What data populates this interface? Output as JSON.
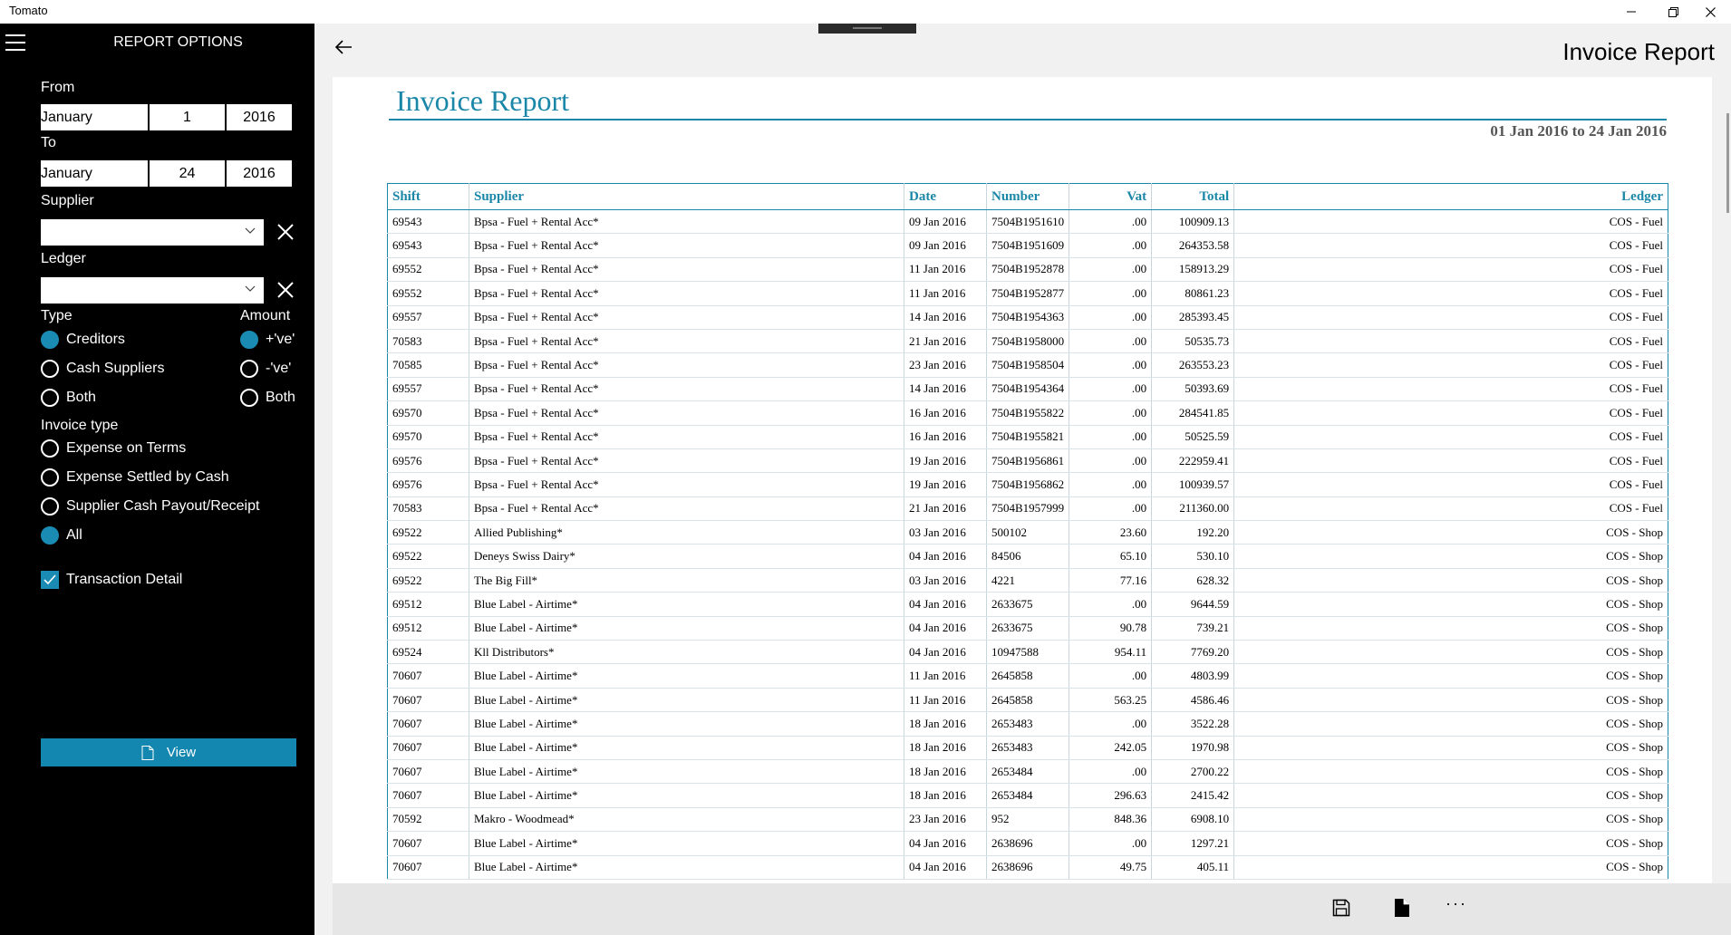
{
  "window": {
    "title": "Tomato",
    "minimize": "—",
    "restore": "❐",
    "close": "✕"
  },
  "sidebar": {
    "title": "REPORT OPTIONS",
    "from_label": "From",
    "from": {
      "month": "January",
      "day": "1",
      "year": "2016"
    },
    "to_label": "To",
    "to": {
      "month": "January",
      "day": "24",
      "year": "2016"
    },
    "supplier_label": "Supplier",
    "supplier_value": "",
    "ledger_label": "Ledger",
    "ledger_value": "",
    "type_label": "Type",
    "type_options": [
      "Creditors",
      "Cash Suppliers",
      "Both"
    ],
    "type_selected": "Creditors",
    "amount_label": "Amount",
    "amount_options": [
      "+'ve'",
      "-'ve'",
      "Both"
    ],
    "amount_selected": "+'ve'",
    "invoice_type_label": "Invoice type",
    "invoice_type_options": [
      "Expense on Terms",
      "Expense Settled by Cash",
      "Supplier Cash Payout/Receipt",
      "All"
    ],
    "invoice_type_selected": "All",
    "transaction_detail_label": "Transaction Detail",
    "transaction_detail_checked": true,
    "view_label": "View",
    "accent_color": "#1a8bb3"
  },
  "header": {
    "title": "Invoice Report"
  },
  "report": {
    "title": "Invoice Report",
    "date_range": "01 Jan 2016 to 24 Jan 2016",
    "columns": [
      "Shift",
      "Supplier",
      "Date",
      "Number",
      "Vat",
      "Total",
      "Ledger"
    ],
    "rows": [
      [
        "69543",
        "Bpsa - Fuel + Rental Acc*",
        "09 Jan 2016",
        "7504B1951610",
        ".00",
        "100909.13",
        "COS - Fuel"
      ],
      [
        "69543",
        "Bpsa - Fuel + Rental Acc*",
        "09 Jan 2016",
        "7504B1951609",
        ".00",
        "264353.58",
        "COS - Fuel"
      ],
      [
        "69552",
        "Bpsa - Fuel + Rental Acc*",
        "11 Jan 2016",
        "7504B1952878",
        ".00",
        "158913.29",
        "COS - Fuel"
      ],
      [
        "69552",
        "Bpsa - Fuel + Rental Acc*",
        "11 Jan 2016",
        "7504B1952877",
        ".00",
        "80861.23",
        "COS - Fuel"
      ],
      [
        "69557",
        "Bpsa - Fuel + Rental Acc*",
        "14 Jan 2016",
        "7504B1954363",
        ".00",
        "285393.45",
        "COS - Fuel"
      ],
      [
        "70583",
        "Bpsa - Fuel + Rental Acc*",
        "21 Jan 2016",
        "7504B1958000",
        ".00",
        "50535.73",
        "COS - Fuel"
      ],
      [
        "70585",
        "Bpsa - Fuel + Rental Acc*",
        "23 Jan 2016",
        "7504B1958504",
        ".00",
        "263553.23",
        "COS - Fuel"
      ],
      [
        "69557",
        "Bpsa - Fuel + Rental Acc*",
        "14 Jan 2016",
        "7504B1954364",
        ".00",
        "50393.69",
        "COS - Fuel"
      ],
      [
        "69570",
        "Bpsa - Fuel + Rental Acc*",
        "16 Jan 2016",
        "7504B1955822",
        ".00",
        "284541.85",
        "COS - Fuel"
      ],
      [
        "69570",
        "Bpsa - Fuel + Rental Acc*",
        "16 Jan 2016",
        "7504B1955821",
        ".00",
        "50525.59",
        "COS - Fuel"
      ],
      [
        "69576",
        "Bpsa - Fuel + Rental Acc*",
        "19 Jan 2016",
        "7504B1956861",
        ".00",
        "222959.41",
        "COS - Fuel"
      ],
      [
        "69576",
        "Bpsa - Fuel + Rental Acc*",
        "19 Jan 2016",
        "7504B1956862",
        ".00",
        "100939.57",
        "COS - Fuel"
      ],
      [
        "70583",
        "Bpsa - Fuel + Rental Acc*",
        "21 Jan 2016",
        "7504B1957999",
        ".00",
        "211360.00",
        "COS - Fuel"
      ],
      [
        "69522",
        "Allied Publishing*",
        "03 Jan 2016",
        "500102",
        "23.60",
        "192.20",
        "COS - Shop"
      ],
      [
        "69522",
        "Deneys Swiss Dairy*",
        "04 Jan 2016",
        "84506",
        "65.10",
        "530.10",
        "COS - Shop"
      ],
      [
        "69522",
        "The Big Fill*",
        "03 Jan 2016",
        "4221",
        "77.16",
        "628.32",
        "COS - Shop"
      ],
      [
        "69512",
        "Blue Label - Airtime*",
        "04 Jan 2016",
        "2633675",
        ".00",
        "9644.59",
        "COS - Shop"
      ],
      [
        "69512",
        "Blue Label - Airtime*",
        "04 Jan 2016",
        "2633675",
        "90.78",
        "739.21",
        "COS - Shop"
      ],
      [
        "69524",
        "Kll Distributors*",
        "04 Jan 2016",
        "10947588",
        "954.11",
        "7769.20",
        "COS - Shop"
      ],
      [
        "70607",
        "Blue Label - Airtime*",
        "11 Jan 2016",
        "2645858",
        ".00",
        "4803.99",
        "COS - Shop"
      ],
      [
        "70607",
        "Blue Label - Airtime*",
        "11 Jan 2016",
        "2645858",
        "563.25",
        "4586.46",
        "COS - Shop"
      ],
      [
        "70607",
        "Blue Label - Airtime*",
        "18 Jan 2016",
        "2653483",
        ".00",
        "3522.28",
        "COS - Shop"
      ],
      [
        "70607",
        "Blue Label - Airtime*",
        "18 Jan 2016",
        "2653483",
        "242.05",
        "1970.98",
        "COS - Shop"
      ],
      [
        "70607",
        "Blue Label - Airtime*",
        "18 Jan 2016",
        "2653484",
        ".00",
        "2700.22",
        "COS - Shop"
      ],
      [
        "70607",
        "Blue Label - Airtime*",
        "18 Jan 2016",
        "2653484",
        "296.63",
        "2415.42",
        "COS - Shop"
      ],
      [
        "70592",
        "Makro - Woodmead*",
        "23 Jan 2016",
        "952",
        "848.36",
        "6908.10",
        "COS - Shop"
      ],
      [
        "70607",
        "Blue Label - Airtime*",
        "04 Jan 2016",
        "2638696",
        ".00",
        "1297.21",
        "COS - Shop"
      ],
      [
        "70607",
        "Blue Label - Airtime*",
        "04 Jan 2016",
        "2638696",
        "49.75",
        "405.11",
        "COS - Shop"
      ]
    ]
  },
  "bottombar": {
    "icons": [
      "save-icon",
      "document-icon"
    ],
    "more": "···"
  }
}
